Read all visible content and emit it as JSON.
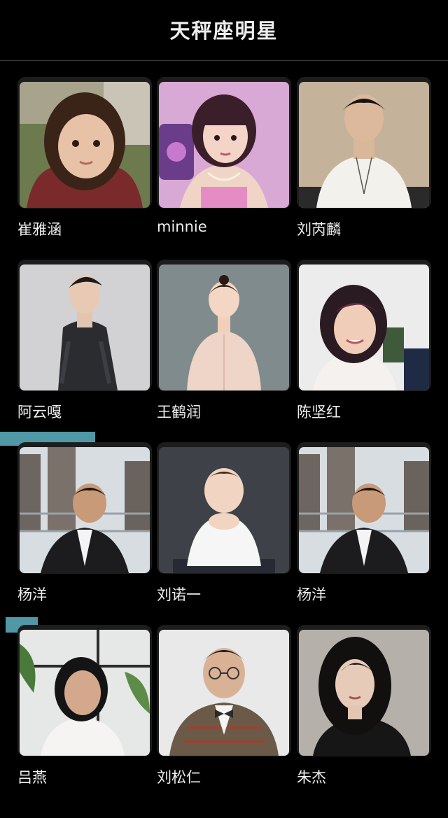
{
  "header": {
    "title": "天秤座明星"
  },
  "stars": [
    {
      "name": "崔雅涵",
      "photo": "photo-child-girl"
    },
    {
      "name": "minnie",
      "photo": "photo-woman-pink"
    },
    {
      "name": "刘芮麟",
      "photo": "photo-man-tshirt"
    },
    {
      "name": "阿云嘎",
      "photo": "photo-man-black-jacket"
    },
    {
      "name": "王鹤润",
      "photo": "photo-woman-blouse"
    },
    {
      "name": "陈坚红",
      "photo": "photo-woman-smiling"
    },
    {
      "name": "杨洋",
      "photo": "photo-man-city"
    },
    {
      "name": "刘诺一",
      "photo": "photo-boy"
    },
    {
      "name": "杨洋",
      "photo": "photo-man-city"
    },
    {
      "name": "吕燕",
      "photo": "photo-woman-window"
    },
    {
      "name": "刘松仁",
      "photo": "photo-man-bowtie"
    },
    {
      "name": "朱杰",
      "photo": "photo-woman-dark-hair"
    }
  ]
}
